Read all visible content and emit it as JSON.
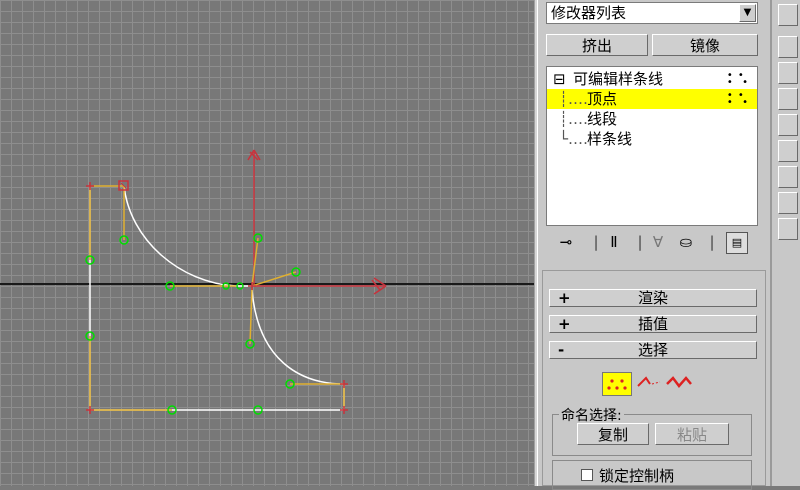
{
  "modifier_list": {
    "label": "修改器列表"
  },
  "buttons": {
    "extrude": "挤出",
    "mirror": "镜像"
  },
  "stack": {
    "root": "可编辑样条线",
    "items": [
      "顶点",
      "线段",
      "样条线"
    ],
    "root_toggle": "⊟"
  },
  "rollouts": [
    {
      "sign": "+",
      "title": "渲染"
    },
    {
      "sign": "+",
      "title": "插值"
    },
    {
      "sign": "-",
      "title": "选择"
    }
  ],
  "named_selection": {
    "title": "命名选择:",
    "copy": "复制",
    "paste": "粘贴"
  },
  "lock_handles": {
    "label": "锁定控制柄"
  },
  "colors": {
    "highlight": "#ffff00",
    "axis_red": "#c8323c",
    "knot_green": "#00dc00",
    "handle_yellow": "#e0b030"
  }
}
